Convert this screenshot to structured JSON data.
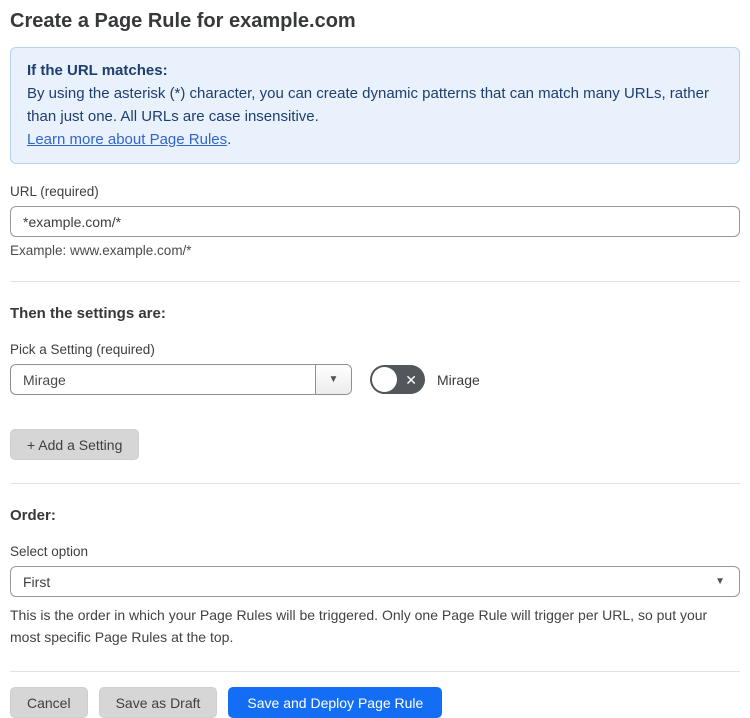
{
  "page": {
    "title": "Create a Page Rule for example.com"
  },
  "info_box": {
    "heading": "If the URL matches:",
    "body": "By using the asterisk (*) character, you can create dynamic patterns that can match many URLs, rather than just one. All URLs are case insensitive.",
    "link_label": "Learn more about Page Rules",
    "link_suffix": "."
  },
  "url_field": {
    "label": "URL (required)",
    "value": "*example.com/*",
    "helper": "Example: www.example.com/*"
  },
  "settings": {
    "heading": "Then the settings are:",
    "picker_label": "Pick a Setting (required)",
    "picker_value": "Mirage",
    "toggle_label": "Mirage",
    "toggle_state": "off",
    "add_button_label": "+ Add a Setting"
  },
  "order": {
    "heading": "Order:",
    "select_label": "Select option",
    "select_value": "First",
    "helper": "This is the order in which your Page Rules will be triggered. Only one Page Rule will trigger per URL, so put your most specific Page Rules at the top."
  },
  "footer": {
    "cancel_label": "Cancel",
    "save_draft_label": "Save as Draft",
    "save_deploy_label": "Save and Deploy Page Rule"
  },
  "icons": {
    "dropdown_arrow": "▼",
    "toggle_x": "✕"
  },
  "colors": {
    "info_bg": "#e9f1fc",
    "info_border": "#b5d2f2",
    "info_text": "#1e3e70",
    "link_blue": "#3166c8",
    "primary_blue": "#146ef5",
    "toggle_off_gray": "#53565a",
    "button_gray": "#d6d6d6"
  }
}
